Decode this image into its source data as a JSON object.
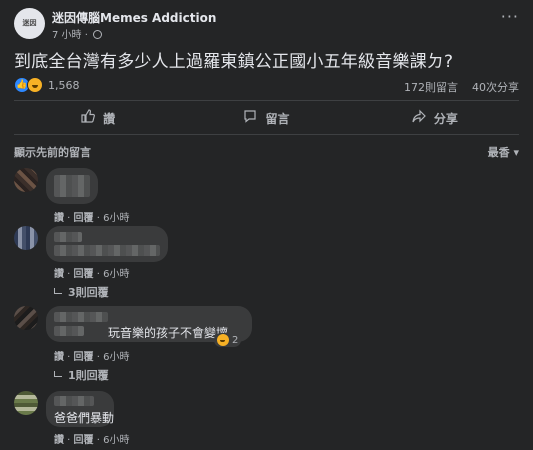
{
  "post": {
    "page_avatar_text": "迷因",
    "page_name": "迷因傳腦Memes Addiction",
    "time": "7 小時",
    "text": "到底全台灣有多少人上過羅東鎮公正國小五年級音樂課ㄉ?",
    "more_icon": "ellipsis-icon"
  },
  "stats": {
    "reactions": "1,568",
    "comments": "172則留言",
    "shares": "40次分享"
  },
  "actions": {
    "like": "讚",
    "comment": "留言",
    "share": "分享"
  },
  "sort": {
    "label": "顯示先前的留言",
    "selected": "最香"
  },
  "comments": [
    {
      "text": "",
      "like": "讚",
      "reply": "回覆",
      "time": "6小時",
      "replies": ""
    },
    {
      "text": "",
      "like": "讚",
      "reply": "回覆",
      "time": "6小時",
      "replies": "3則回覆"
    },
    {
      "text": "玩音樂的孩子不會變壞",
      "like": "讚",
      "reply": "回覆",
      "time": "6小時",
      "replies": "1則回覆",
      "reaction_count": "2"
    },
    {
      "text": "爸爸們暴動",
      "like": "讚",
      "reply": "回覆",
      "time": "6小時",
      "replies": ""
    }
  ],
  "colors": {
    "background": "#242526",
    "bubble": "#3a3b3c",
    "accent": "#2d88ff"
  }
}
